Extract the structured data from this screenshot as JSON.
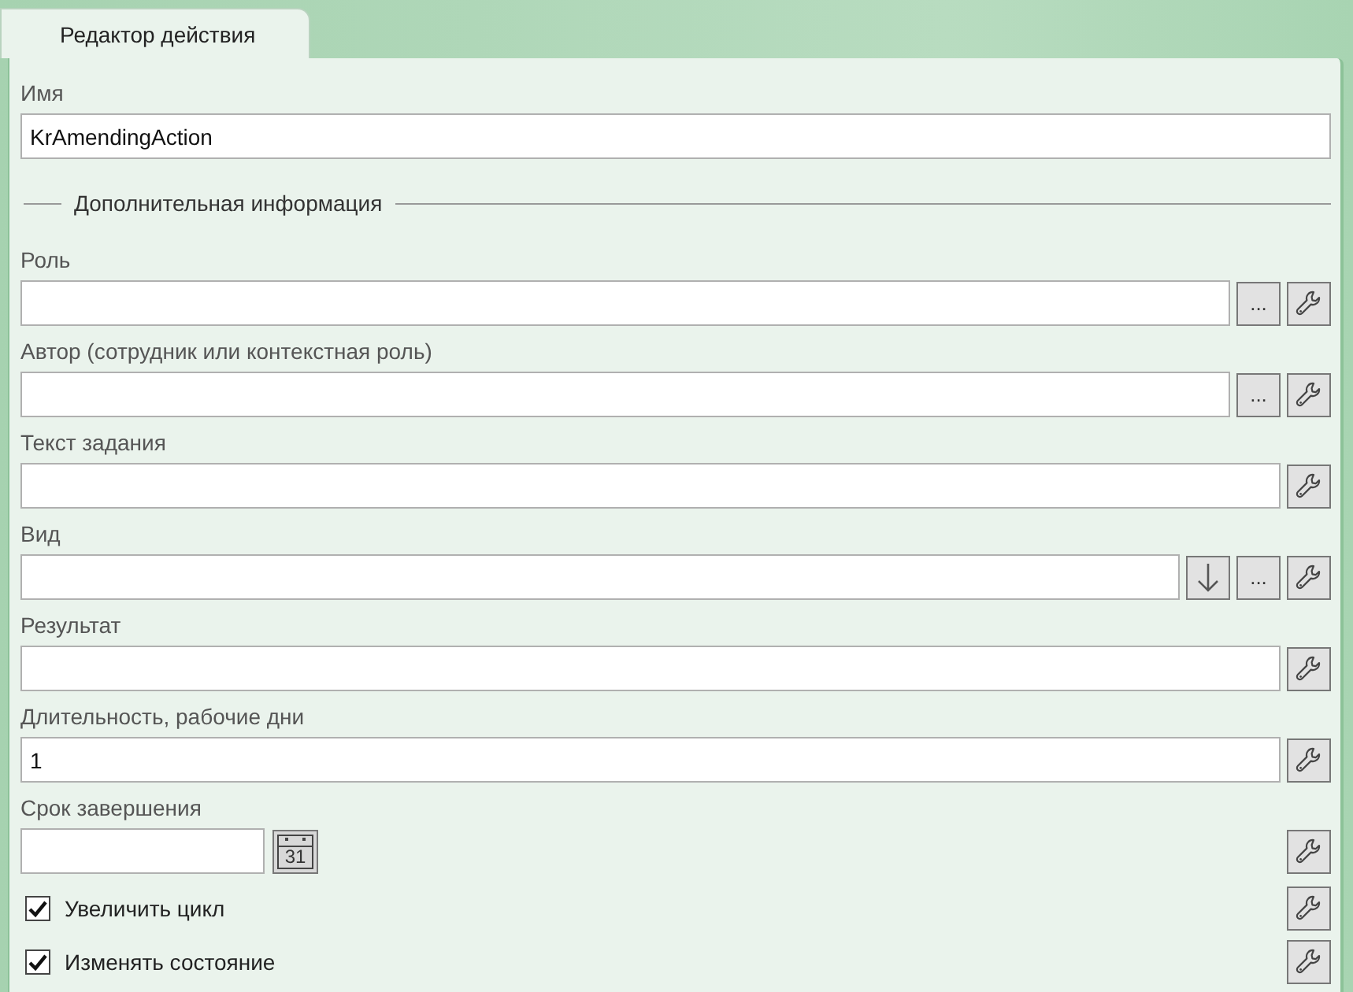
{
  "tab": {
    "label": "Редактор действия",
    "selected": true
  },
  "name_field": {
    "label": "Имя",
    "value": "KrAmendingAction"
  },
  "section_title": "Дополнительная информация",
  "rows": [
    {
      "kind": "field",
      "label": "Роль",
      "buttons": [
        {
          "kind": "browse",
          "text": "..."
        },
        {
          "kind": "settings"
        }
      ]
    },
    {
      "kind": "field",
      "label": "Автор (сотрудник или контекстная роль)",
      "buttons": [
        {
          "kind": "browse",
          "text": "..."
        },
        {
          "kind": "settings"
        }
      ]
    },
    {
      "kind": "field",
      "label": "Текст задания",
      "buttons": [
        {
          "kind": "settings"
        }
      ]
    },
    {
      "kind": "field",
      "label": "Вид",
      "buttons": [
        {
          "kind": "dropdown"
        },
        {
          "kind": "browse",
          "text": "..."
        },
        {
          "kind": "settings"
        }
      ]
    },
    {
      "kind": "field",
      "label": "Результат",
      "buttons": [
        {
          "kind": "settings"
        }
      ]
    },
    {
      "kind": "field",
      "label": "Длительность, рабочие дни",
      "value": "1",
      "buttons": [
        {
          "kind": "settings"
        }
      ]
    },
    {
      "kind": "date",
      "label": "Срок завершения",
      "calendar_day": "31",
      "buttons": [
        {
          "kind": "settings"
        }
      ]
    },
    {
      "kind": "checkbox",
      "label": "Увеличить цикл",
      "checked": true,
      "buttons": [
        {
          "kind": "settings"
        }
      ]
    },
    {
      "kind": "checkbox",
      "label": "Изменять состояние",
      "checked": true,
      "buttons": [
        {
          "kind": "settings"
        }
      ]
    }
  ]
}
